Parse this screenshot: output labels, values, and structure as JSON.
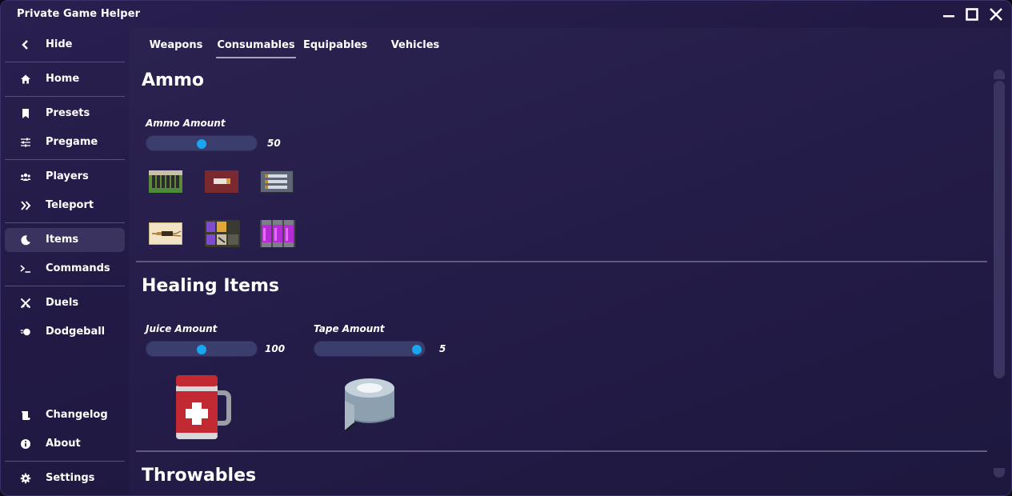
{
  "app": {
    "title": "Private Game Helper"
  },
  "window_controls": {
    "minimize_icon": "minimize-icon",
    "maximize_icon": "maximize-icon",
    "close_icon": "close-icon"
  },
  "sidebar": {
    "items": [
      {
        "label": "Hide",
        "icon": "chevron-left-icon"
      },
      {
        "label": "Home",
        "icon": "home-icon"
      },
      {
        "label": "Presets",
        "icon": "bookmark-icon"
      },
      {
        "label": "Pregame",
        "icon": "sliders-icon"
      },
      {
        "label": "Players",
        "icon": "users-icon"
      },
      {
        "label": "Teleport",
        "icon": "double-chevron-right-icon"
      },
      {
        "label": "Items",
        "icon": "moon-icon",
        "active": true
      },
      {
        "label": "Commands",
        "icon": "terminal-icon"
      },
      {
        "label": "Duels",
        "icon": "crossed-swords-icon"
      },
      {
        "label": "Dodgeball",
        "icon": "ball-icon"
      },
      {
        "label": "Changelog",
        "icon": "scroll-icon"
      },
      {
        "label": "About",
        "icon": "info-icon"
      },
      {
        "label": "Settings",
        "icon": "gear-icon"
      }
    ]
  },
  "tabs": [
    {
      "label": "Weapons"
    },
    {
      "label": "Consumables",
      "active": true
    },
    {
      "label": "Equipables"
    },
    {
      "label": "Vehicles"
    }
  ],
  "sections": {
    "ammo": {
      "title": "Ammo",
      "amount_label": "Ammo Amount",
      "amount_value": "50",
      "amount_fraction": 0.5,
      "items": [
        {
          "icon": "light-ammo-icon"
        },
        {
          "icon": "shells-ammo-icon"
        },
        {
          "icon": "medium-ammo-icon"
        },
        {
          "icon": "heavy-ammo-icon"
        },
        {
          "icon": "rockets-ammo-icon"
        },
        {
          "icon": "energy-ammo-icon"
        }
      ]
    },
    "healing": {
      "title": "Healing Items",
      "juice_label": "Juice Amount",
      "juice_value": "100",
      "juice_fraction": 0.5,
      "tape_label": "Tape Amount",
      "tape_value": "5",
      "tape_fraction": 1.0,
      "items": [
        {
          "icon": "health-juice-icon"
        },
        {
          "icon": "tape-icon"
        }
      ]
    },
    "throwables": {
      "title": "Throwables"
    }
  },
  "colors": {
    "accent": "#1aa5f0",
    "slider_track": "#3b3d6d",
    "active_nav": "#3a3360"
  }
}
